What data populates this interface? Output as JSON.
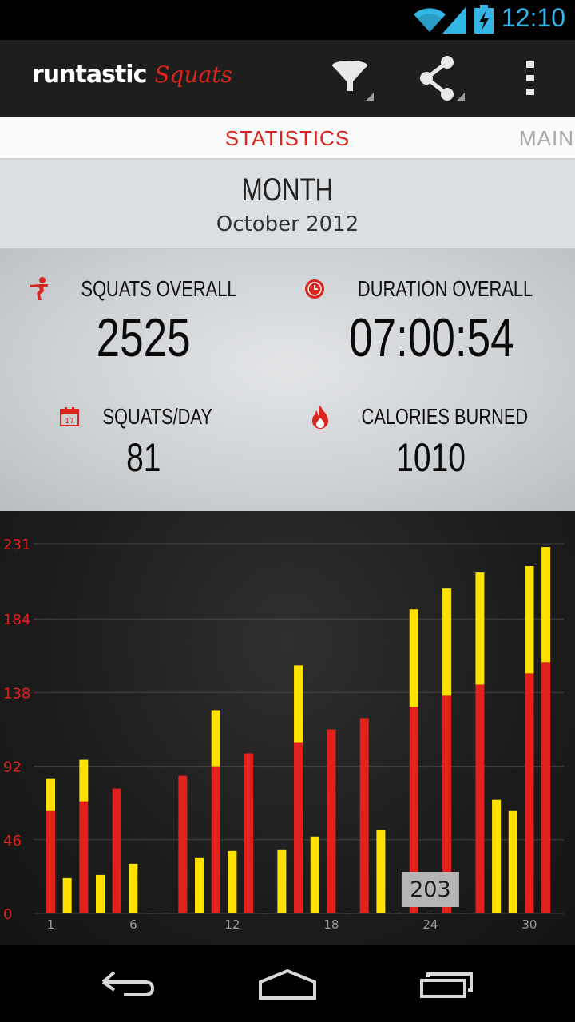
{
  "status_bar": {
    "time": "12:10",
    "icons": [
      "wifi-icon",
      "signal-icon",
      "battery-charging-icon"
    ],
    "time_color": "#33b5e5"
  },
  "action_bar": {
    "brand": "runtastic",
    "app_name": "Squats",
    "actions": [
      "filter-icon",
      "share-icon",
      "overflow-menu-icon"
    ]
  },
  "tabs": {
    "active": "STATISTICS",
    "next": "MAIN",
    "active_color": "#d9251d"
  },
  "period": {
    "label": "MONTH",
    "value": "October 2012"
  },
  "stats": {
    "squats_overall": {
      "label": "SQUATS OVERALL",
      "value": "2525",
      "icon": "squat-person-icon"
    },
    "duration_overall": {
      "label": "DURATION OVERALL",
      "value": "07:00:54",
      "icon": "clock-icon"
    },
    "squats_per_day": {
      "label": "SQUATS/DAY",
      "value": "81",
      "icon": "calendar-icon"
    },
    "calories_burned": {
      "label": "CALORIES BURNED",
      "value": "1010",
      "icon": "flame-icon"
    },
    "accent_color": "#d9251d"
  },
  "chart_data": {
    "type": "bar",
    "stacked": true,
    "ylim": [
      0,
      231
    ],
    "yticks": [
      "231",
      "184",
      "138",
      "92",
      "46",
      "0"
    ],
    "xticks": [
      "1",
      "6",
      "12",
      "18",
      "24",
      "30"
    ],
    "days": [
      1,
      2,
      3,
      4,
      5,
      6,
      7,
      8,
      9,
      10,
      11,
      12,
      13,
      14,
      15,
      16,
      17,
      18,
      19,
      20,
      21,
      22,
      23,
      24,
      25,
      26,
      27,
      28,
      29,
      30,
      31
    ],
    "series": [
      {
        "color": "#e3211c",
        "values": [
          64,
          0,
          70,
          0,
          78,
          0,
          0,
          0,
          86,
          0,
          92,
          0,
          100,
          0,
          0,
          107,
          0,
          115,
          0,
          122,
          0,
          0,
          129,
          0,
          136,
          0,
          143,
          0,
          0,
          150,
          157
        ]
      },
      {
        "color": "#ffe100",
        "values": [
          20,
          22,
          26,
          24,
          0,
          31,
          0,
          0,
          0,
          35,
          35,
          39,
          0,
          0,
          40,
          48,
          48,
          0,
          0,
          0,
          52,
          0,
          61,
          0,
          67,
          0,
          70,
          71,
          64,
          67,
          72
        ]
      }
    ],
    "tooltip": {
      "day": 24,
      "label": "203"
    },
    "grid": true
  },
  "nav_bar": {
    "buttons": [
      "back-icon",
      "home-icon",
      "recent-apps-icon"
    ]
  }
}
